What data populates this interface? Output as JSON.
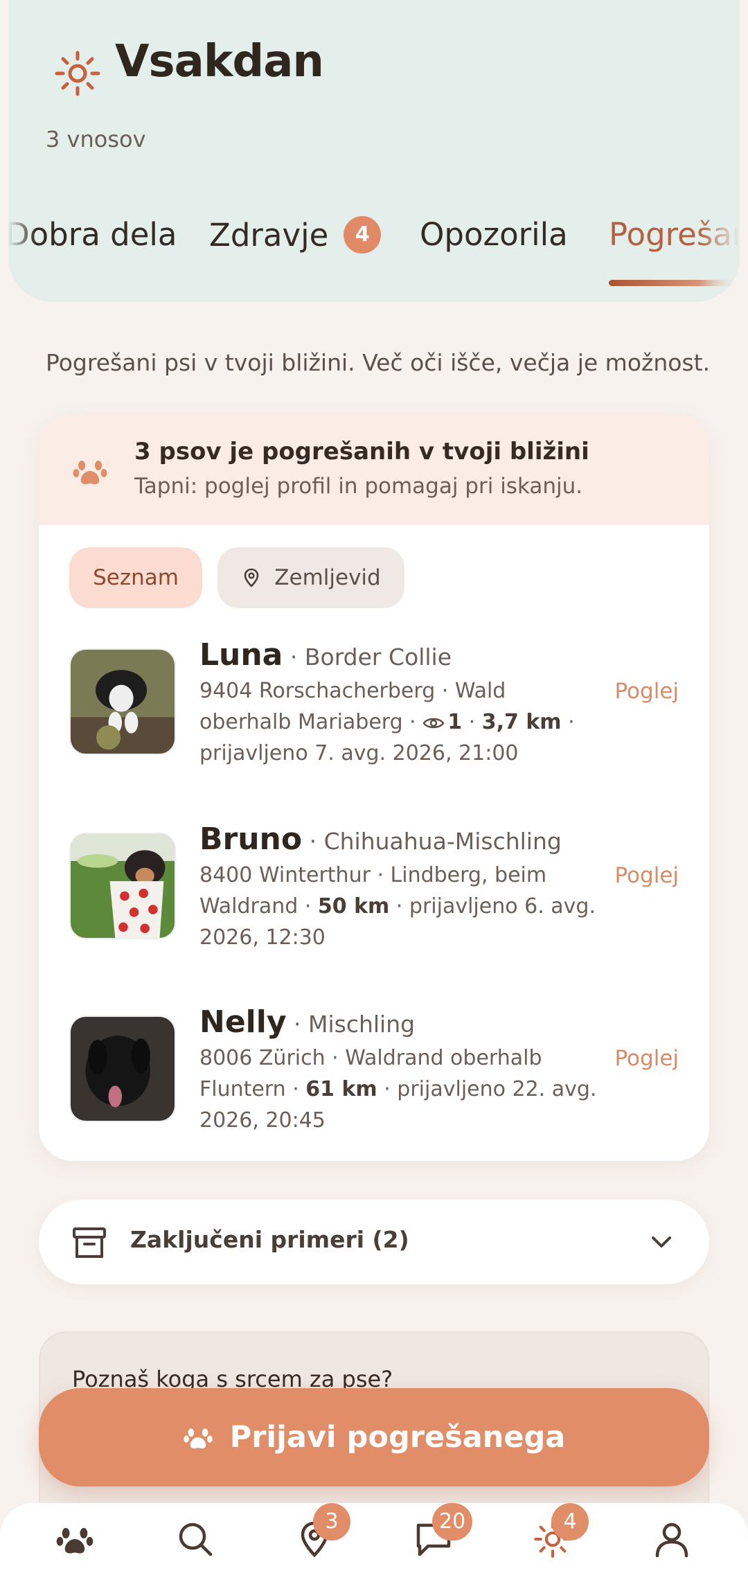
{
  "header": {
    "title": "Vsakdan",
    "subtitle": "3 vnosov",
    "tabs": [
      {
        "label": "Dobra dela"
      },
      {
        "label": "Zdravje",
        "badge": "4"
      },
      {
        "label": "Opozorila"
      },
      {
        "label": "Pogrešani"
      }
    ]
  },
  "intro": "Pogrešani psi v tvoji bližini. Več oči išče, večja je možnost.",
  "banner": {
    "title": "3 psov je pogrešanih v tvoji bližini",
    "subtitle": "Tapni: poglej profil in pomagaj pri iskanju."
  },
  "segments": {
    "list": "Seznam",
    "map": "Zemljevid"
  },
  "dogs": [
    {
      "name": "Luna",
      "breed": " · Border Collie",
      "line1": "9404 Rorschacherberg · Wald",
      "line2_a": "oberhalb Mariaberg · ",
      "views": "1",
      "sep": " · ",
      "distance": "3,7 km",
      "line2_b": " ·",
      "line3": "prijavljeno 7. avg. 2026, 21:00",
      "action": "Poglej"
    },
    {
      "name": "Bruno",
      "breed": " · Chihuahua-Mischling",
      "line1": "8400 Winterthur · Lindberg, beim",
      "line2_a": "Waldrand · ",
      "distance": "50 km",
      "line2_b": " · prijavljeno 6. avg.",
      "line3": "2026, 12:30",
      "action": "Poglej"
    },
    {
      "name": "Nelly",
      "breed": " · Mischling",
      "line1": "8006 Zürich · Waldrand oberhalb",
      "line2_a": "Fluntern · ",
      "distance": "61 km",
      "line2_b": " · prijavljeno 22. avg.",
      "line3": "2026, 20:45",
      "action": "Poglej"
    }
  ],
  "closed": {
    "label": "Zaključeni primeri (2)"
  },
  "invite": {
    "text": "Poznaš koga s srcem za pse?"
  },
  "fab": {
    "label": "Prijavi pogrešanega"
  },
  "nav": {
    "badges": {
      "map": "3",
      "messages": "20",
      "daily": "4"
    }
  },
  "colors": {
    "accent": "#e08d68",
    "header_bg": "#e4eeea",
    "active_tab": "#b5603f"
  }
}
